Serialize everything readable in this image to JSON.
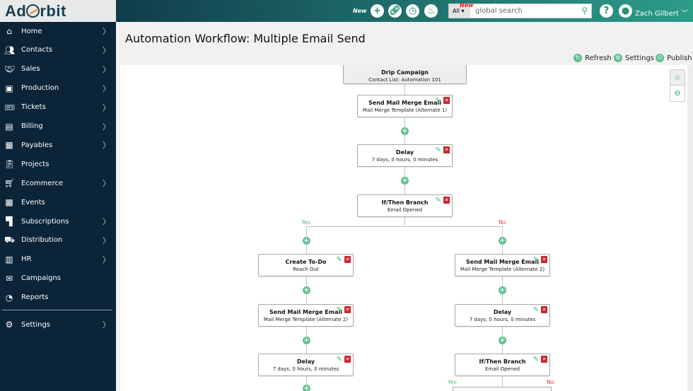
{
  "brand": {
    "logo": "AdOrbit"
  },
  "topbar": {
    "new_label": "New",
    "search_scope": "All",
    "search_badge": "New",
    "search_placeholder": "global search",
    "user_name": "Zach Gilbert"
  },
  "sidebar": {
    "items": [
      {
        "label": "Home",
        "icon": "home-icon",
        "chevron": true
      },
      {
        "label": "Contacts",
        "icon": "contacts-icon",
        "chevron": true
      },
      {
        "label": "Sales",
        "icon": "handshake-icon",
        "chevron": true
      },
      {
        "label": "Production",
        "icon": "image-icon",
        "chevron": true
      },
      {
        "label": "Tickets",
        "icon": "ticket-icon",
        "chevron": true
      },
      {
        "label": "Billing",
        "icon": "billing-icon",
        "chevron": true
      },
      {
        "label": "Payables",
        "icon": "payables-icon",
        "chevron": true
      },
      {
        "label": "Projects",
        "icon": "clipboard-icon",
        "chevron": false
      },
      {
        "label": "Ecommerce",
        "icon": "cart-icon",
        "chevron": true
      },
      {
        "label": "Events",
        "icon": "calendar-icon",
        "chevron": false
      },
      {
        "label": "Subscriptions",
        "icon": "subscriptions-icon",
        "chevron": true
      },
      {
        "label": "Distribution",
        "icon": "truck-icon",
        "chevron": true
      },
      {
        "label": "HR",
        "icon": "w2-icon",
        "chevron": true
      },
      {
        "label": "Campaigns",
        "icon": "envelope-icon",
        "chevron": false
      },
      {
        "label": "Reports",
        "icon": "reports-icon",
        "chevron": false
      }
    ],
    "settings": "Settings"
  },
  "page": {
    "title": "Automation Workflow: Multiple Email Send",
    "actions": {
      "refresh": "Refresh",
      "settings": "Settings",
      "publish": "Publish"
    }
  },
  "workflow": {
    "root": {
      "title": "Drip Campaign",
      "subtitle": "Contact List: Automation 101"
    },
    "nodes": [
      {
        "title": "Send Mail Merge Email",
        "subtitle": "Mail Merge Template (Alternate 1)"
      },
      {
        "title": "Delay",
        "subtitle": "7 days, 0 hours, 0 minutes"
      },
      {
        "title": "If/Then Branch",
        "subtitle": "Email Opened"
      },
      {
        "title": "Create To-Do",
        "subtitle": "Reach Out"
      },
      {
        "title": "Send Mail Merge Email",
        "subtitle": "Mail Merge Template (Alternate 2)"
      },
      {
        "title": "Delay",
        "subtitle": "7 days, 0 hours, 0 minutes"
      },
      {
        "title": "Send Mail Merge Email",
        "subtitle": "Mail Merge Template (Alternate 2)"
      },
      {
        "title": "Delay",
        "subtitle": "7 days, 0 hours, 0 minutes"
      },
      {
        "title": "If/Then Branch",
        "subtitle": "Email Opened"
      }
    ],
    "yes": "Yes",
    "no": "No"
  },
  "colors": {
    "accent": "#5fc18f",
    "sidebar": "#0b2438",
    "delete": "#c9262c",
    "no": "#e03c3c"
  }
}
